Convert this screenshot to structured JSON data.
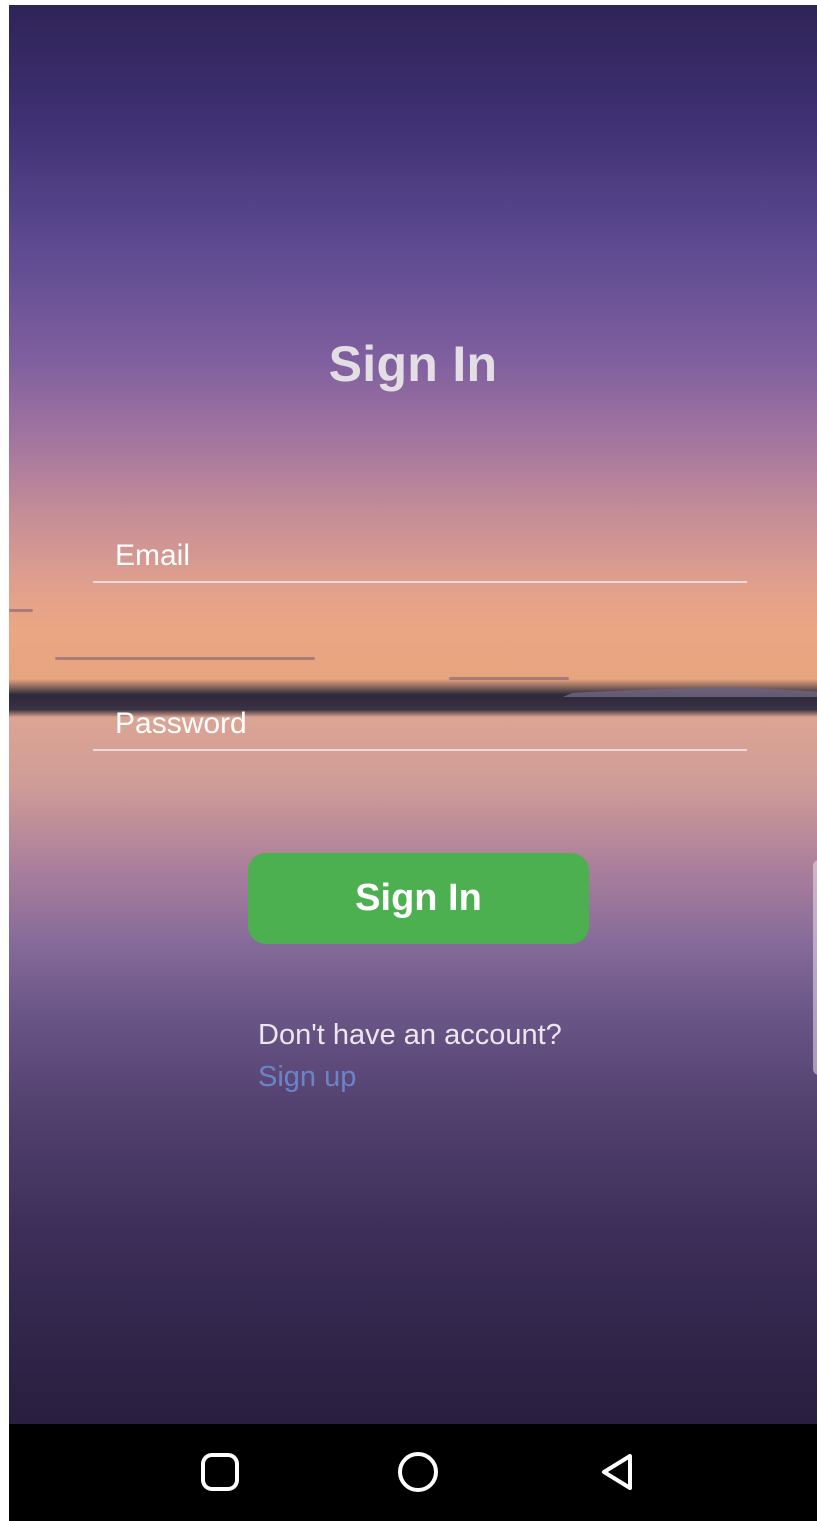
{
  "screen": {
    "title": "Sign In"
  },
  "form": {
    "email": {
      "value": "",
      "placeholder": "Email"
    },
    "password": {
      "value": "",
      "placeholder": "Password"
    },
    "submit_label": "Sign In"
  },
  "footer": {
    "prompt": "Don't have an account?",
    "signup_label": "Sign up"
  },
  "navbar": {
    "buttons": [
      {
        "icon": "recents-square-icon"
      },
      {
        "icon": "home-circle-icon"
      },
      {
        "icon": "back-triangle-icon"
      }
    ]
  },
  "colors": {
    "button": "#4caf50",
    "link": "#6b84c6",
    "navbar": "#000000"
  }
}
